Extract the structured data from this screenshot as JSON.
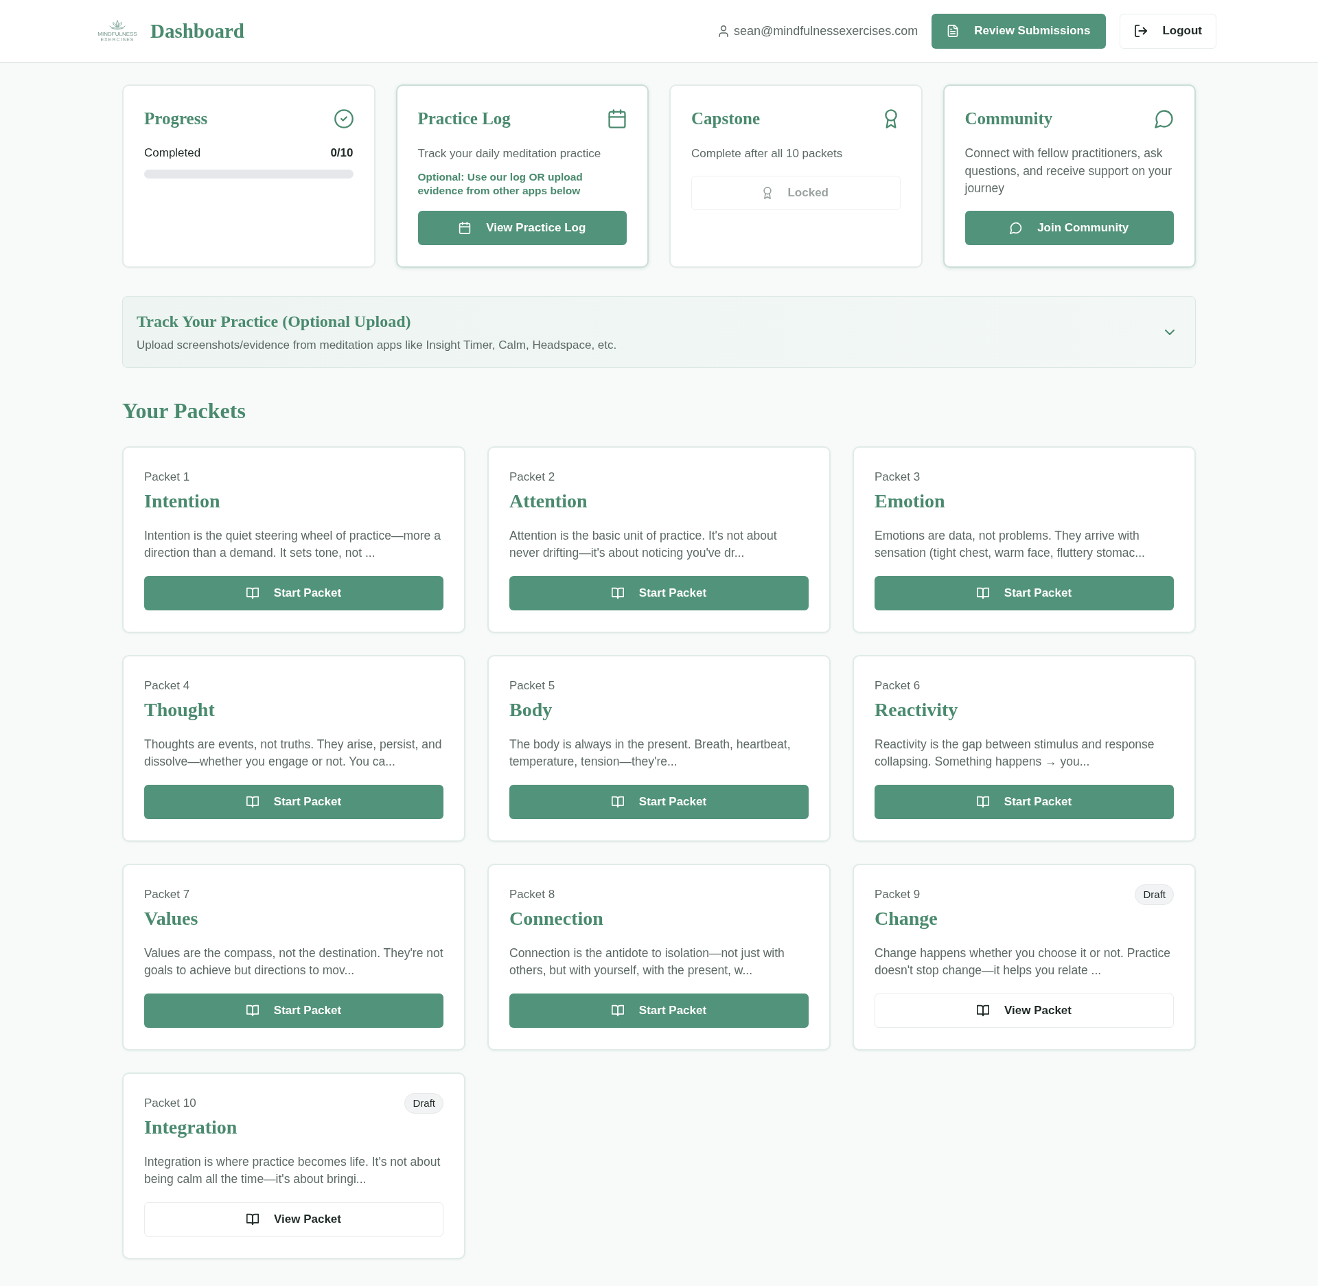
{
  "header": {
    "logo": {
      "wordmark": "MINDFULNESS",
      "tagline": "EXERCISES"
    },
    "title": "Dashboard",
    "user_email": "sean@mindfulnessexercises.com",
    "review_button": {
      "label": "Review Submissions"
    },
    "logout_button": {
      "label": "Logout"
    }
  },
  "summary_cards": [
    {
      "kind": "progress",
      "title": "Progress",
      "highlighted": false,
      "label": "Completed",
      "count": "0/10",
      "level": 0
    },
    {
      "kind": "practice_log",
      "title": "Practice Log",
      "highlighted": true,
      "description": "Track your daily meditation practice",
      "note": "Optional: Use our log OR upload evidence from other apps below",
      "button": {
        "label": "View Practice Log",
        "disabled": false
      }
    },
    {
      "kind": "capstone",
      "title": "Capstone",
      "highlighted": false,
      "description": "Complete after all 10 packets",
      "button": {
        "label": "Locked",
        "disabled": true
      }
    },
    {
      "kind": "community",
      "title": "Community",
      "highlighted": true,
      "description": "Connect with fellow practitioners, ask questions, and receive support on your journey",
      "button": {
        "label": "Join Community",
        "disabled": false
      }
    }
  ],
  "upload_panel": {
    "title": "Track Your Practice (Optional Upload)",
    "description": "Upload screenshots/evidence from meditation apps like Insight Timer, Calm, Headspace, etc.",
    "expanded": false
  },
  "packets_heading": "Your Packets",
  "packets": [
    {
      "label": "Packet 1",
      "title": "Intention",
      "description": "Intention is the quiet steering wheel of practice—more a direction than a demand. It sets tone, not ...",
      "button": {
        "kind": "primary",
        "label": "Start Packet"
      }
    },
    {
      "label": "Packet 2",
      "title": "Attention",
      "description": "Attention is the basic unit of practice. It's not about never drifting—it's about noticing you've dr...",
      "button": {
        "kind": "primary",
        "label": "Start Packet"
      }
    },
    {
      "label": "Packet 3",
      "title": "Emotion",
      "description": "Emotions are data, not problems. They arrive with sensation (tight chest, warm face, fluttery stomac...",
      "button": {
        "kind": "primary",
        "label": "Start Packet"
      }
    },
    {
      "label": "Packet 4",
      "title": "Thought",
      "description": "Thoughts are events, not truths. They arise, persist, and dissolve—whether you engage or not. You ca...",
      "button": {
        "kind": "primary",
        "label": "Start Packet"
      }
    },
    {
      "label": "Packet 5",
      "title": "Body",
      "description": "The body is always in the present. Breath, heartbeat, temperature, tension—they're...",
      "button": {
        "kind": "primary",
        "label": "Start Packet"
      }
    },
    {
      "label": "Packet 6",
      "title": "Reactivity",
      "description": "Reactivity is the gap between stimulus and response collapsing. Something happens → you...",
      "button": {
        "kind": "primary",
        "label": "Start Packet"
      }
    },
    {
      "label": "Packet 7",
      "title": "Values",
      "description": "Values are the compass, not the destination. They're not goals to achieve but directions to mov...",
      "button": {
        "kind": "primary",
        "label": "Start Packet"
      }
    },
    {
      "label": "Packet 8",
      "title": "Connection",
      "description": "Connection is the antidote to isolation—not just with others, but with yourself, with the present, w...",
      "button": {
        "kind": "primary",
        "label": "Start Packet"
      }
    },
    {
      "label": "Packet 9",
      "badge": "Draft",
      "title": "Change",
      "description": "Change happens whether you choose it or not. Practice doesn't stop change—it helps you relate ...",
      "button": {
        "kind": "outline",
        "label": "View Packet"
      }
    },
    {
      "label": "Packet 10",
      "badge": "Draft",
      "title": "Integration",
      "description": "Integration is where practice becomes life. It's not about being calm all the time—it's about bringi...",
      "button": {
        "kind": "outline",
        "label": "View Packet"
      }
    }
  ]
}
